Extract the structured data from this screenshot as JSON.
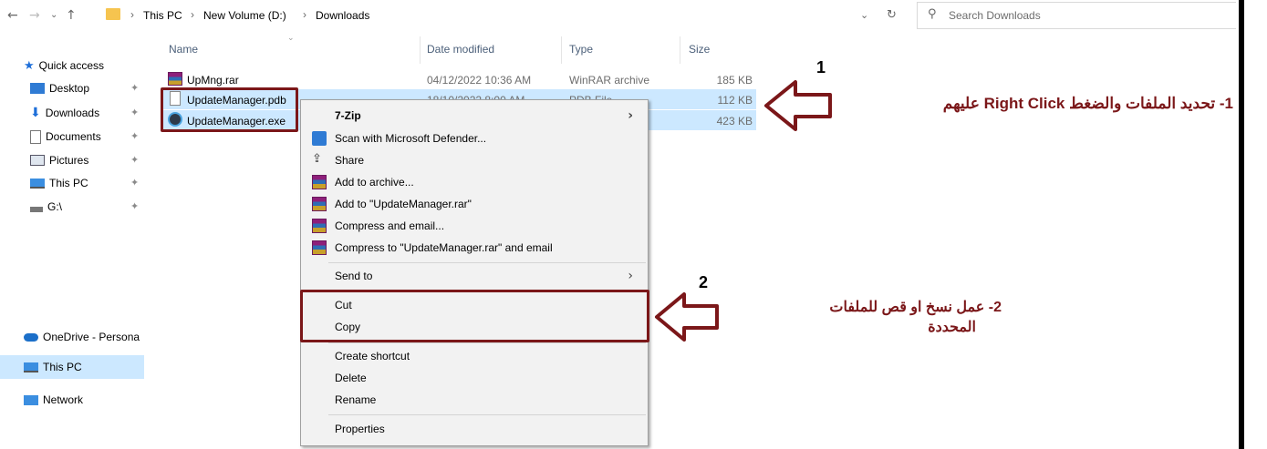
{
  "address": {
    "crumbs": [
      "This PC",
      "New Volume (D:)",
      "Downloads"
    ],
    "search_placeholder": "Search Downloads"
  },
  "sidebar": {
    "quick_access": "Quick access",
    "items": [
      {
        "label": "Desktop",
        "icon": "desktop-folder-icon"
      },
      {
        "label": "Downloads",
        "icon": "download-arrow-icon"
      },
      {
        "label": "Documents",
        "icon": "documents-icon"
      },
      {
        "label": "Pictures",
        "icon": "pictures-icon"
      },
      {
        "label": "This PC",
        "icon": "computer-icon"
      },
      {
        "label": "G:\\",
        "icon": "drive-icon"
      }
    ],
    "onedrive": "OneDrive - Persona",
    "this_pc": "This PC",
    "network": "Network"
  },
  "columns": {
    "name": "Name",
    "date": "Date modified",
    "type": "Type",
    "size": "Size"
  },
  "files": [
    {
      "name": "UpMng.rar",
      "date": "04/12/2022 10:36 AM",
      "type": "WinRAR archive",
      "size": "185 KB"
    },
    {
      "name": "UpdateManager.pdb",
      "date": "18/10/2022 8:00 AM",
      "type": "PDB File",
      "size": "112 KB"
    },
    {
      "name": "UpdateManager.exe",
      "date": "",
      "type": "",
      "size": "423 KB"
    }
  ],
  "menu": {
    "zip": "7-Zip",
    "defender": "Scan with Microsoft Defender...",
    "share": "Share",
    "add_archive": "Add to archive...",
    "add_rar": "Add to \"UpdateManager.rar\"",
    "compress_email": "Compress and email...",
    "compress_rar_email": "Compress to \"UpdateManager.rar\" and email",
    "send_to": "Send to",
    "cut": "Cut",
    "copy": "Copy",
    "create_shortcut": "Create shortcut",
    "delete": "Delete",
    "rename": "Rename",
    "properties": "Properties"
  },
  "annotations": {
    "num1": "1",
    "num2": "2",
    "step1": "1- تحديد الملفات والضغط Right Click عليهم",
    "step2_line1": "2- عمل نسخ او قص للملفات",
    "step2_line2": "المحددة"
  },
  "colors": {
    "annotation": "#7b1719",
    "selection": "#cce8ff",
    "menu_bg": "#f2f2f2"
  }
}
